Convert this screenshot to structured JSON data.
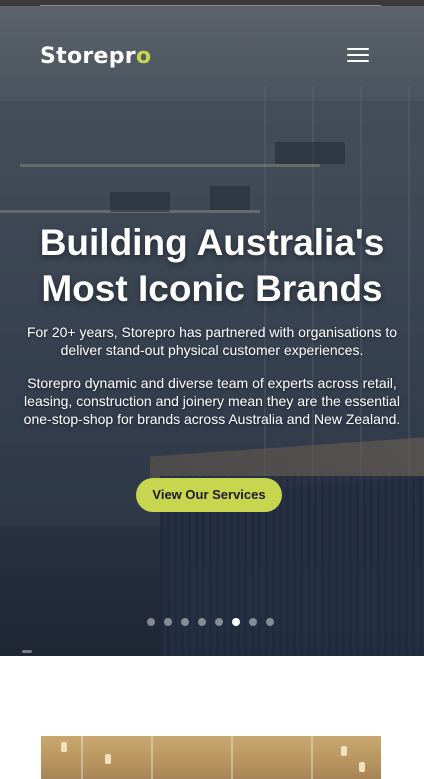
{
  "header": {
    "logo_text": "Storepr",
    "logo_accent": "o",
    "menu_icon": "hamburger-icon"
  },
  "hero": {
    "title": "Building Australia's Most Iconic Brands",
    "paragraph1": "For 20+ years, Storepro has partnered with organisations to deliver stand-out physical customer experiences.",
    "paragraph2": "Storepro dynamic and diverse team of experts across retail, leasing, construction and joinery mean they are the essential one-stop-shop for brands across Australia and New Zealand.",
    "cta_label": "View Our Services",
    "slider": {
      "total_slides": 8,
      "active_slide": 6
    }
  },
  "colors": {
    "accent": "#c7d64f",
    "text": "#ffffff"
  }
}
